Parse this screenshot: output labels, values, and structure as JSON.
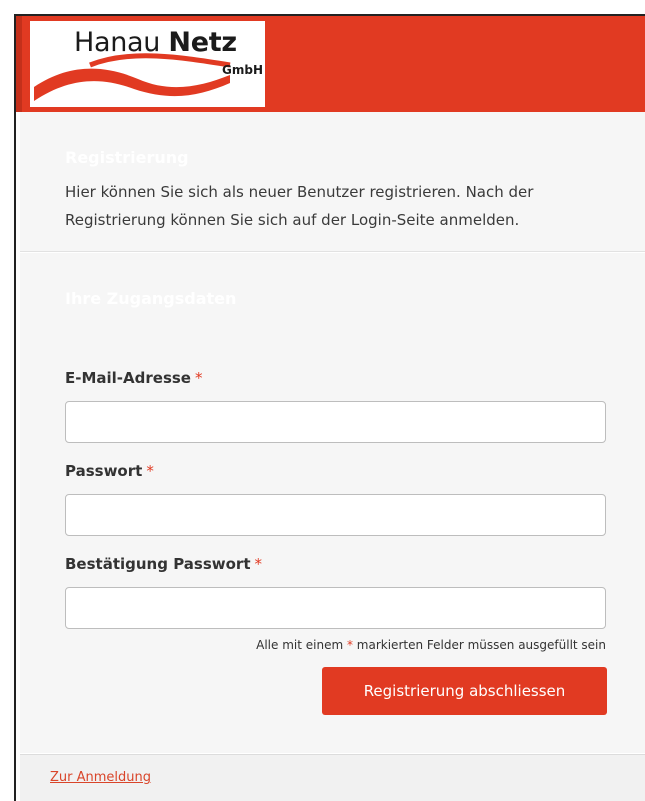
{
  "brand": {
    "name_regular": "Hanau",
    "name_bold": "Netz",
    "suffix": "GmbH",
    "header_color": "#e13a22"
  },
  "intro": {
    "title": "Registrierung",
    "text": "Hier können Sie sich als neuer Benutzer registrieren. Nach der Registrierung können Sie sich auf der Login-Seite anmelden."
  },
  "form": {
    "title": "Ihre Zugangsdaten",
    "fields": [
      {
        "label": "E-Mail-Adresse",
        "required_mark": "*",
        "value": ""
      },
      {
        "label": "Passwort",
        "required_mark": "*",
        "value": ""
      },
      {
        "label": "Bestätigung Passwort",
        "required_mark": "*",
        "value": ""
      }
    ],
    "required_note_prefix": "Alle mit einem",
    "required_note_star": "*",
    "required_note_suffix": "markierten Felder müssen ausgefüllt sein",
    "submit_label": "Registrierung abschliessen"
  },
  "footer": {
    "link_label": "Zur Anmeldung"
  }
}
